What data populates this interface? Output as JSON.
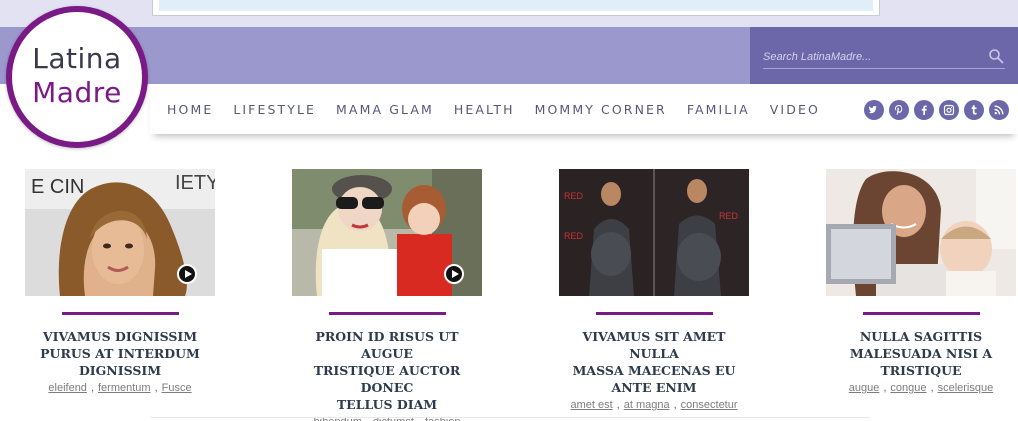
{
  "site": {
    "logo_top": "Latina",
    "logo_bottom": "Madre"
  },
  "search": {
    "placeholder": "Search LatinaMadre..."
  },
  "nav": {
    "items": [
      "HOME",
      "LIFESTYLE",
      "MAMA GLAM",
      "HEALTH",
      "MOMMY CORNER",
      "FAMILIA",
      "VIDEO"
    ]
  },
  "social": [
    "twitter-icon",
    "pinterest-icon",
    "facebook-icon",
    "instagram-icon",
    "tumblr-icon",
    "rss-icon"
  ],
  "colors": {
    "brand_purple": "#7a1a86",
    "band": "#9b98cd",
    "search_panel": "#6c67a9",
    "nav_text": "#57577a",
    "title_text": "#2e3b4d"
  },
  "articles": [
    {
      "title_lines": [
        "VIVAMUS DIGNISSIM",
        "PURUS AT INTERDUM",
        "DIGNISSIM"
      ],
      "tags": [
        "eleifend",
        "fermentum",
        "Fusce"
      ],
      "has_video": true
    },
    {
      "title_lines": [
        "PROIN ID RISUS UT AUGUE",
        "TRISTIQUE AUCTOR DONEC",
        "TELLUS DIAM"
      ],
      "tags": [
        "bibendum",
        "dictumst",
        "fashion"
      ],
      "has_video": true
    },
    {
      "title_lines": [
        "VIVAMUS SIT AMET NULLA",
        "MASSA MAECENAS EU",
        "ANTE ENIM"
      ],
      "tags": [
        "amet est",
        "at magna",
        "consectetur"
      ],
      "has_video": false
    },
    {
      "title_lines": [
        "NULLA SAGITTIS",
        "MALESUADA NISI A",
        "TRISTIQUE"
      ],
      "tags": [
        "augue",
        "congue",
        "scelerisque"
      ],
      "has_video": false
    }
  ]
}
